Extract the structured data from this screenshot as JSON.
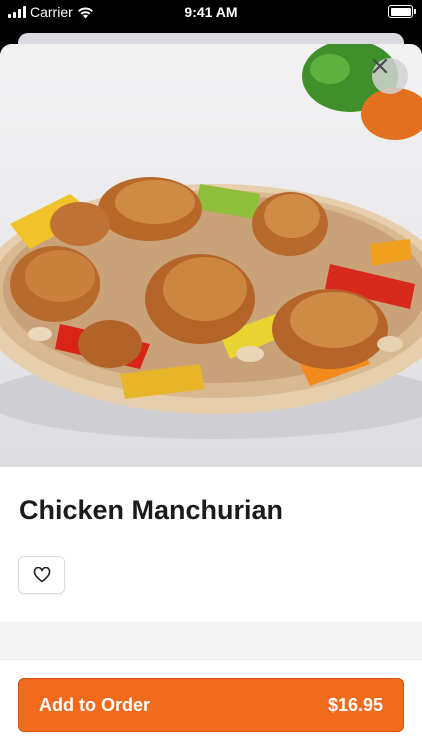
{
  "status_bar": {
    "carrier": "Carrier",
    "time": "9:41 AM"
  },
  "item": {
    "name": "Chicken Manchurian"
  },
  "order_button": {
    "label": "Add to Order",
    "price": "$16.95"
  },
  "colors": {
    "accent": "#f26a1b"
  },
  "icons": {
    "close": "close-icon",
    "favorite": "heart-outline-icon"
  }
}
